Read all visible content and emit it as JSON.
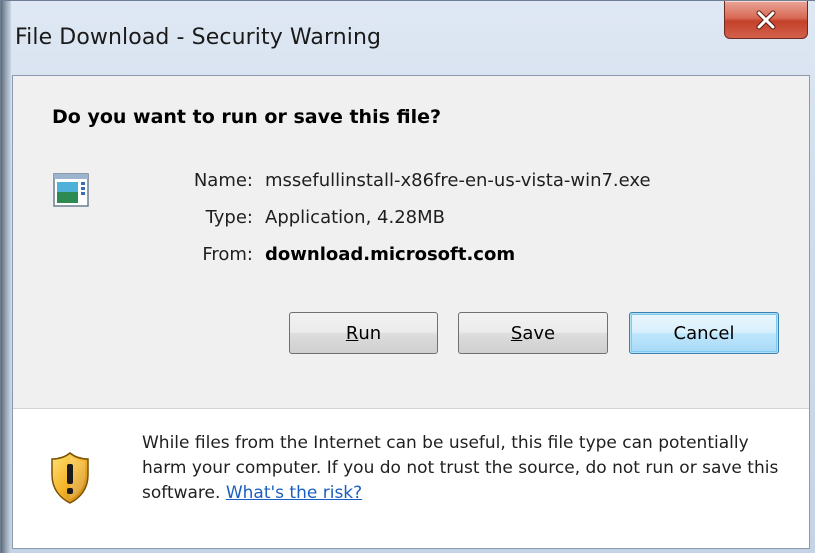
{
  "window": {
    "title": "File Download - Security Warning",
    "close_label": "x"
  },
  "dialog": {
    "question": "Do you want to run or save this file?",
    "file": {
      "name_label": "Name:",
      "name_value": "mssefullinstall-x86fre-en-us-vista-win7.exe",
      "type_label": "Type:",
      "type_value": "Application, 4.28MB",
      "from_label": "From:",
      "from_value": "download.microsoft.com"
    },
    "buttons": {
      "run_accel": "R",
      "run_rest": "un",
      "save_accel": "S",
      "save_rest": "ave",
      "cancel": "Cancel"
    },
    "warning": {
      "text": "While files from the Internet can be useful, this file type can potentially harm your computer. If you do not trust the source, do not run or save this software.",
      "link": "What's the risk?"
    }
  },
  "colors": {
    "link": "#1a5fc0",
    "close_button": "#c4412a",
    "default_button_border": "#3c7fb1"
  },
  "icons": {
    "file": "application-file-icon",
    "shield": "security-shield-icon",
    "close": "close-icon"
  }
}
